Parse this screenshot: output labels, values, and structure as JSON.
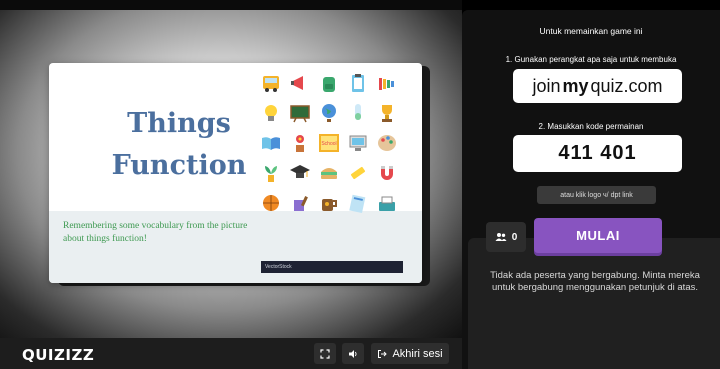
{
  "slide": {
    "title_line1": "Things",
    "title_line2": "Function",
    "caption": "Remembering some vocabulary from the picture about things function!",
    "footer_brand": "VectorStock",
    "icons": [
      "school-bus-icon",
      "megaphone-icon",
      "backpack-icon",
      "clipboard-icon",
      "xylophone-icon",
      "lightbulb-icon",
      "chalkboard-icon",
      "globe-icon",
      "test-tube-icon",
      "trophy-icon",
      "open-book-icon",
      "flower-pot-icon",
      "school-sign-icon",
      "computer-icon",
      "paint-palette-icon",
      "plant-icon",
      "graduation-cap-icon",
      "sandwich-icon",
      "crayon-icon",
      "magnet-icon",
      "basketball-icon",
      "paint-bucket-icon",
      "mug-icon",
      "notebook-icon",
      "scanner-icon"
    ]
  },
  "panel": {
    "heading": "Untuk memainkan game ini",
    "step1": "1. Gunakan perangkat apa saja untuk membuka",
    "join_url_part1": "join",
    "join_url_part2": "my",
    "join_url_part3": "quiz.com",
    "step2": "2. Masukkan kode permainan",
    "game_code": "411 401",
    "link_button": "atau klik logo ч/ dpt link",
    "player_count": "0",
    "start_button": "MULAI",
    "empty_message": "Tidak ada peserta yang bergabung. Minta mereka untuk bergabung menggunakan petunjuk di atas."
  },
  "bottom_bar": {
    "logo": "QUIZIZZ",
    "end_session": "Akhiri sesi"
  },
  "colors": {
    "accent": "#8854c0",
    "title_blue": "#4b6f9e",
    "caption_green": "#3f9a52"
  }
}
